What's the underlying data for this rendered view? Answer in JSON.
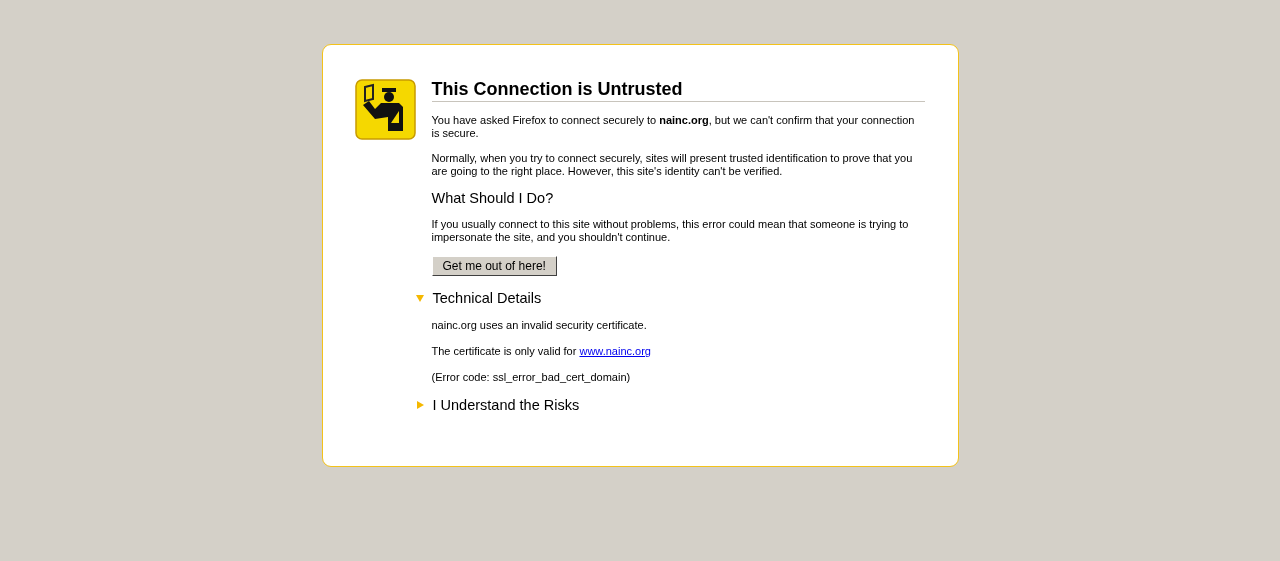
{
  "title": "This Connection is Untrusted",
  "intro": [
    "You have asked Firefox to connect securely to **nainc.org**, but we can't confirm that your connection is secure.",
    "Normally, when you try to connect securely, sites will present trusted identification to prove that you are going to the right place. However, this site's identity can't be verified."
  ],
  "what_to_do": {
    "heading": "What Should I Do?",
    "text": "If you usually connect to this site without problems, this error could mean that someone is trying to impersonate the site, and you shouldn't continue.",
    "button": "Get me out of here!"
  },
  "sections": [
    {
      "heading": "Technical Details",
      "expanded": true,
      "paragraphs": [
        {
          "text": "nainc.org uses an invalid security certificate."
        },
        {
          "text": "The certificate is only valid for ",
          "link": "www.nainc.org"
        },
        {
          "text": "(Error code: ssl_error_bad_cert_domain)"
        }
      ]
    },
    {
      "heading": "I Understand the Risks",
      "expanded": false
    }
  ]
}
